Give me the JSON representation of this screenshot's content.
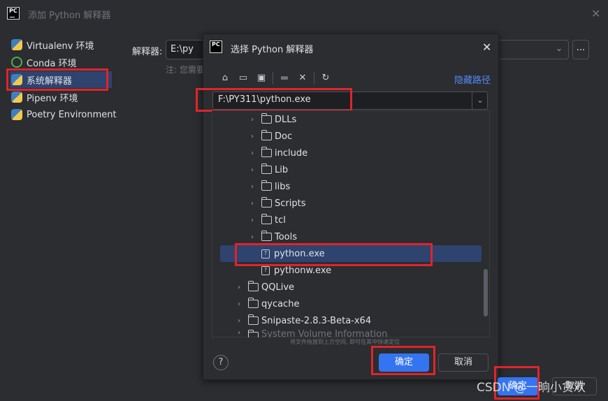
{
  "window": {
    "title": "添加 Python 解释器"
  },
  "sidebar": {
    "items": [
      {
        "label": "Virtualenv 环境",
        "icon": "python-icon"
      },
      {
        "label": "Conda 环境",
        "icon": "conda-icon"
      },
      {
        "label": "系统解释器",
        "icon": "python-icon",
        "selected": true
      },
      {
        "label": "Pipenv 环境",
        "icon": "python-icon"
      },
      {
        "label": "Poetry Environment",
        "icon": "poetry-icon"
      }
    ]
  },
  "main": {
    "interpreter_label": "解释器:",
    "interpreter_value": "E:\\py",
    "note": "注: 您需要",
    "more_button": "..."
  },
  "dialog": {
    "title": "选择 Python 解释器",
    "hide_path": "隐藏路径",
    "path": "F:\\PY311\\python.exe",
    "toolbar": [
      "home-icon",
      "desktop-icon",
      "project-icon",
      "new-folder-icon",
      "delete-icon",
      "refresh-icon"
    ],
    "tree": [
      {
        "type": "folder",
        "label": "DLLs"
      },
      {
        "type": "folder",
        "label": "Doc"
      },
      {
        "type": "folder",
        "label": "include"
      },
      {
        "type": "folder",
        "label": "Lib"
      },
      {
        "type": "folder",
        "label": "libs"
      },
      {
        "type": "folder",
        "label": "Scripts"
      },
      {
        "type": "folder",
        "label": "tcl"
      },
      {
        "type": "folder",
        "label": "Tools"
      },
      {
        "type": "file",
        "label": "python.exe",
        "selected": true
      },
      {
        "type": "file",
        "label": "pythonw.exe"
      },
      {
        "type": "folder",
        "label": "QQLive"
      },
      {
        "type": "folder",
        "label": "qycache"
      },
      {
        "type": "folder",
        "label": "Snipaste-2.8.3-Beta-x64"
      },
      {
        "type": "folder",
        "label": "System Volume Information"
      }
    ],
    "hint": "将文件拖放到上方空间, 即可在其中快速定位",
    "ok": "确定",
    "cancel": "取消",
    "help": "?"
  },
  "footer": {
    "ok": "确定",
    "cancel": "取消"
  },
  "watermark": "CSDN @一晌小贪欢",
  "colors": {
    "accent": "#3574f0",
    "selection": "#2e436e",
    "highlight_box": "#e0242b"
  }
}
